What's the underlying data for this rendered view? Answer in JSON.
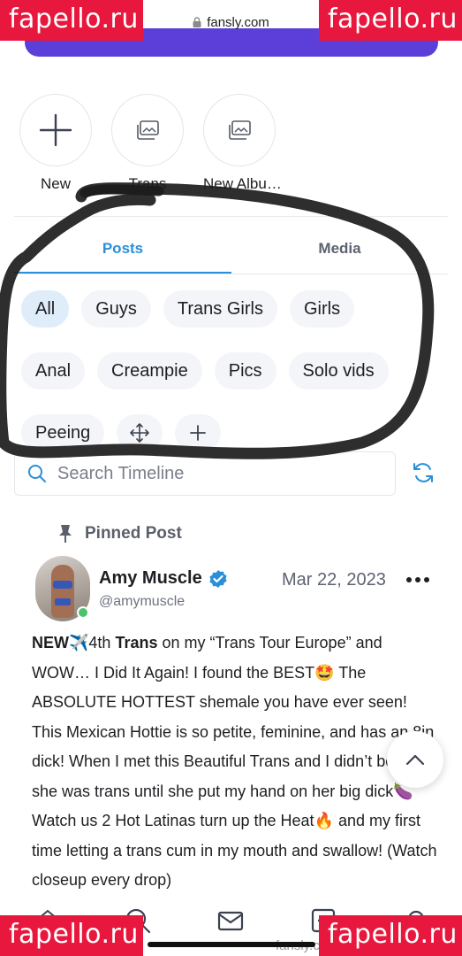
{
  "browser": {
    "url": "fansly.com"
  },
  "watermark": {
    "text": "fapello.ru"
  },
  "albums": [
    {
      "label": "New",
      "icon": "plus-icon"
    },
    {
      "label": "Trans",
      "icon": "gallery-icon"
    },
    {
      "label": "New Albu…",
      "icon": "gallery-icon"
    }
  ],
  "tabs": {
    "posts": "Posts",
    "media": "Media",
    "active": "Posts"
  },
  "filters": {
    "row1": [
      "All",
      "Guys",
      "Trans Girls",
      "Girls"
    ],
    "row2": [
      "Anal",
      "Creampie",
      "Pics",
      "Solo vids"
    ],
    "row3": [
      "Peeing"
    ],
    "active": "All",
    "icons": [
      "move-icon",
      "plus-icon"
    ]
  },
  "search": {
    "placeholder": "Search Timeline"
  },
  "pinned": {
    "label": "Pinned Post"
  },
  "post": {
    "author": "Amy Muscle",
    "handle": "@amymuscle",
    "date": "Mar 22, 2023",
    "text_lead": "NEW",
    "text_p1": "4th ",
    "text_bold": "Trans",
    "text_p2": " on my “Trans Tour Europe” and WOW… I Did It Again! I found the BEST",
    "text_p3": " The ABSOLUTE HOTTEST shemale you have ever seen! This Mexican Hottie is so petite, feminine, and has an 8in dick! When I met this Beautiful Trans and I didn’t believe she was trans until she put my hand on her big dick",
    "text_p4": " Watch us 2 Hot Latinas turn up the Heat",
    "text_p5": " and my first time letting a trans cum in my mouth and swallow! (Watch closeup every drop)"
  },
  "bottom_url": "fansly.com",
  "colors": {
    "accent": "#2a8fd8",
    "watermark": "#e8173d",
    "online": "#4cc36a",
    "verified": "#2a8fd8"
  }
}
